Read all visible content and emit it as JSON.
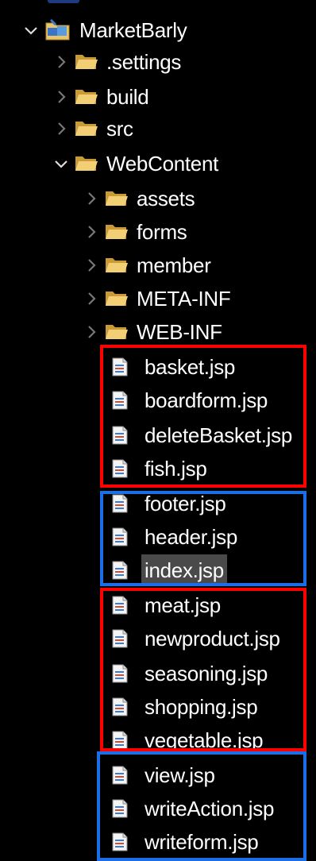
{
  "colors": {
    "background": "#000000",
    "text": "#ffffff",
    "folder": "#e8c46a",
    "red_box": "#ff0000",
    "blue_box": "#1a6fe6",
    "selection": "#4a4a4a"
  },
  "project": {
    "name": "MarketBarly",
    "icon": "project-icon",
    "expanded": true
  },
  "folders": [
    {
      "label": ".settings",
      "expanded": false,
      "icon": "folder-icon"
    },
    {
      "label": "build",
      "expanded": false,
      "icon": "folder-icon"
    },
    {
      "label": "src",
      "expanded": false,
      "icon": "folder-icon"
    },
    {
      "label": "WebContent",
      "expanded": true,
      "icon": "folder-icon"
    }
  ],
  "webcontent_folders": [
    {
      "label": "assets",
      "expanded": false,
      "icon": "folder-icon"
    },
    {
      "label": "forms",
      "expanded": false,
      "icon": "folder-icon"
    },
    {
      "label": "member",
      "expanded": false,
      "icon": "folder-icon"
    },
    {
      "label": "META-INF",
      "expanded": false,
      "icon": "folder-icon"
    },
    {
      "label": "WEB-INF",
      "expanded": false,
      "icon": "folder-icon"
    }
  ],
  "files": [
    {
      "label": "basket.jsp",
      "icon": "jsp-file-icon"
    },
    {
      "label": "boardform.jsp",
      "icon": "jsp-file-icon"
    },
    {
      "label": "deleteBasket.jsp",
      "icon": "jsp-file-icon"
    },
    {
      "label": "fish.jsp",
      "icon": "jsp-file-icon"
    },
    {
      "label": "footer.jsp",
      "icon": "jsp-file-icon"
    },
    {
      "label": "header.jsp",
      "icon": "jsp-file-icon"
    },
    {
      "label": "index.jsp",
      "icon": "jsp-file-icon",
      "selected": true
    },
    {
      "label": "meat.jsp",
      "icon": "jsp-file-icon"
    },
    {
      "label": "newproduct.jsp",
      "icon": "jsp-file-icon"
    },
    {
      "label": "seasoning.jsp",
      "icon": "jsp-file-icon"
    },
    {
      "label": "shopping.jsp",
      "icon": "jsp-file-icon"
    },
    {
      "label": "vegetable.jsp",
      "icon": "jsp-file-icon"
    },
    {
      "label": "view.jsp",
      "icon": "jsp-file-icon"
    },
    {
      "label": "writeAction.jsp",
      "icon": "jsp-file-icon"
    },
    {
      "label": "writeform.jsp",
      "icon": "jsp-file-icon"
    }
  ]
}
